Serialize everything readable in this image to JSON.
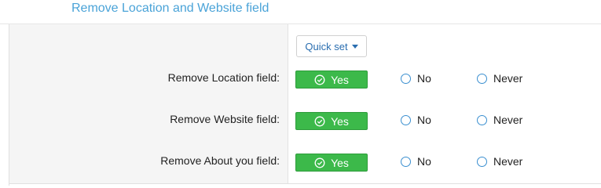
{
  "header": {
    "title": "Remove Location and Website field"
  },
  "quickset": {
    "label": "Quick set"
  },
  "rows": [
    {
      "label": "Remove Location field:",
      "yes": "Yes",
      "no": "No",
      "never": "Never"
    },
    {
      "label": "Remove Website field:",
      "yes": "Yes",
      "no": "No",
      "never": "Never"
    },
    {
      "label": "Remove About you field:",
      "yes": "Yes",
      "no": "No",
      "never": "Never"
    }
  ],
  "colors": {
    "accent": "#4aa3d8",
    "yes_active": "#3cb94a",
    "radio": "#3a8fd0"
  }
}
